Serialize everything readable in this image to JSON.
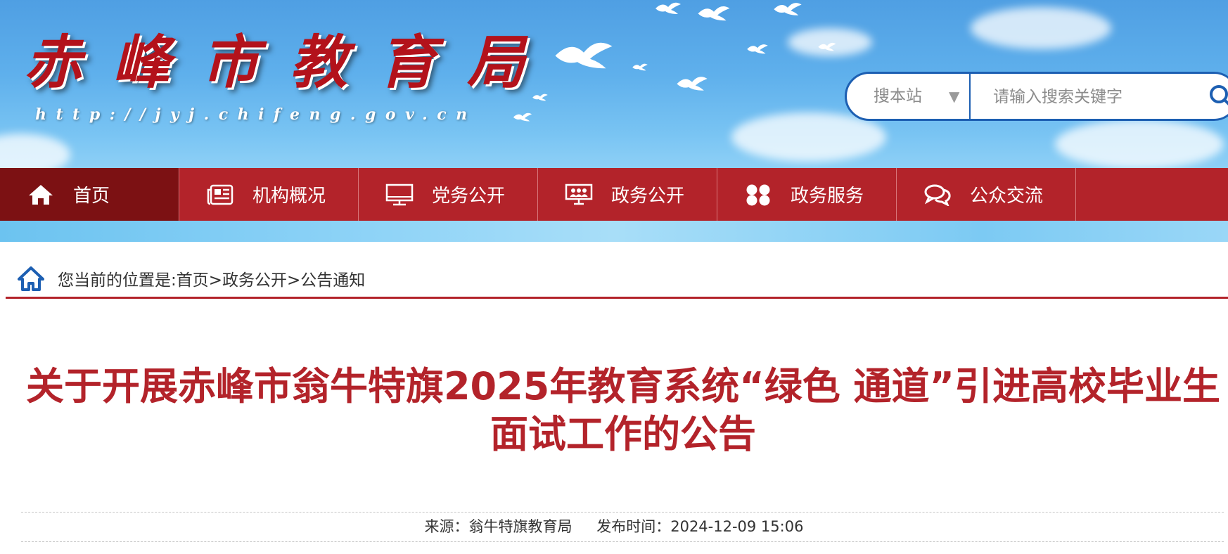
{
  "header": {
    "site_title": "赤峰市教育局",
    "site_url": "http://jyj.chifeng.gov.cn",
    "search": {
      "scope_label": "搜本站",
      "placeholder": "请输入搜索关键字"
    }
  },
  "nav": {
    "items": [
      {
        "label": "首页",
        "icon": "home-icon",
        "active": true
      },
      {
        "label": "机构概况",
        "icon": "newspaper-icon",
        "active": false
      },
      {
        "label": "党务公开",
        "icon": "monitor-icon",
        "active": false
      },
      {
        "label": "政务公开",
        "icon": "presentation-icon",
        "active": false
      },
      {
        "label": "政务服务",
        "icon": "grid-icon",
        "active": false
      },
      {
        "label": "公众交流",
        "icon": "chat-bubbles-icon",
        "active": false
      }
    ]
  },
  "breadcrumb": {
    "text": "您当前的位置是:首页>政务公开>公告通知"
  },
  "article": {
    "title_line1": "关于开展赤峰市翁牛特旗2025年教育系统“绿色 通道”引进高校毕业生",
    "title_line2": "面试工作的公告",
    "source": "来源：翁牛特旗教育局",
    "published": "发布时间：2024-12-09 15:06"
  },
  "colors": {
    "brand_red": "#b3232a",
    "nav_active": "#7c1113",
    "search_border": "#1d5fb2",
    "sky": "#5fb0ec"
  }
}
